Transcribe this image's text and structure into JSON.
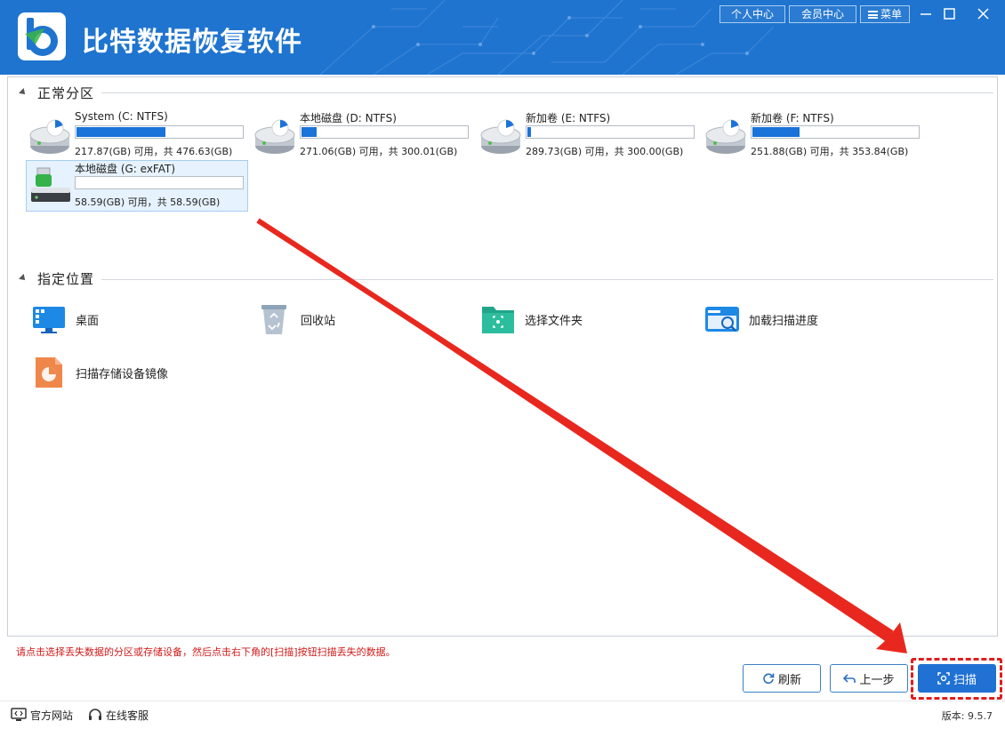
{
  "app": {
    "title": "比特数据恢复软件",
    "brand_color": "#1f74cf"
  },
  "topbar": {
    "personal_center": "个人中心",
    "member_center": "会员中心",
    "menu": "菜单"
  },
  "sections": {
    "normal_partitions": "正常分区",
    "specific_locations": "指定位置"
  },
  "partitions": [
    {
      "name": "System (C: NTFS)",
      "info": "217.87(GB) 可用，共 476.63(GB)",
      "used_fraction": 0.54,
      "icon": "hard-drive-icon"
    },
    {
      "name": "本地磁盘 (D: NTFS)",
      "info": "271.06(GB) 可用，共 300.01(GB)",
      "used_fraction": 0.1,
      "icon": "hard-drive-icon"
    },
    {
      "name": "新加卷 (E: NTFS)",
      "info": "289.73(GB) 可用，共 300.00(GB)",
      "used_fraction": 0.03,
      "icon": "hard-drive-icon"
    },
    {
      "name": "新加卷 (F: NTFS)",
      "info": "251.88(GB) 可用，共 353.84(GB)",
      "used_fraction": 0.29,
      "icon": "hard-drive-icon"
    },
    {
      "name": "本地磁盘 (G: exFAT)",
      "info": "58.59(GB) 可用，共 58.59(GB)",
      "used_fraction": 0.0,
      "icon": "usb-drive-icon",
      "selected": true
    }
  ],
  "locations": [
    {
      "label": "桌面",
      "icon": "desktop-icon"
    },
    {
      "label": "回收站",
      "icon": "recycle-bin-icon"
    },
    {
      "label": "选择文件夹",
      "icon": "folder-icon"
    },
    {
      "label": "加载扫描进度",
      "icon": "load-scan-progress-icon"
    },
    {
      "label": "扫描存储设备镜像",
      "icon": "disk-image-icon"
    }
  ],
  "hint": "请点击选择丢失数据的分区或存储设备，然后点击右下角的[扫描]按钮扫描丢失的数据。",
  "buttons": {
    "refresh": "刷新",
    "back": "上一步",
    "scan": "扫描"
  },
  "footer": {
    "official_site": "官方网站",
    "online_service": "在线客服",
    "version": "版本: 9.5.7"
  }
}
